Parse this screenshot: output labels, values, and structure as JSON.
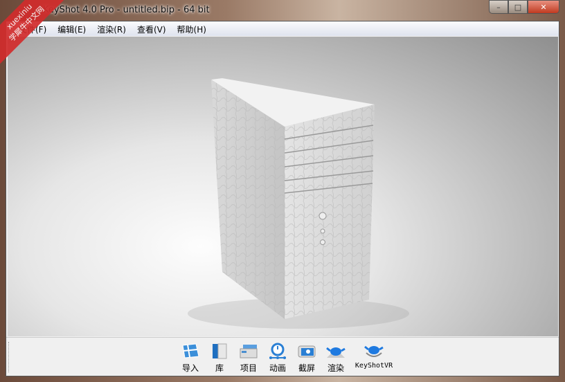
{
  "window": {
    "title": "KeyShot 4.0 Pro  - untitled.bip  - 64 bit",
    "minimize": "–",
    "maximize": "□",
    "close": "✕"
  },
  "menu": [
    "文件(F)",
    "编辑(E)",
    "渲染(R)",
    "查看(V)",
    "帮助(H)"
  ],
  "toolbar": [
    {
      "label": "导入",
      "icon": "import-icon"
    },
    {
      "label": "库",
      "icon": "library-icon"
    },
    {
      "label": "项目",
      "icon": "project-icon"
    },
    {
      "label": "动画",
      "icon": "animation-icon"
    },
    {
      "label": "截屏",
      "icon": "screenshot-icon"
    },
    {
      "label": "渲染",
      "icon": "render-icon"
    },
    {
      "label": "KeyShotVR",
      "icon": "keyshotvr-icon"
    }
  ],
  "watermark": {
    "line1": "xuexiniu",
    "line2": "学犀牛中文网"
  }
}
